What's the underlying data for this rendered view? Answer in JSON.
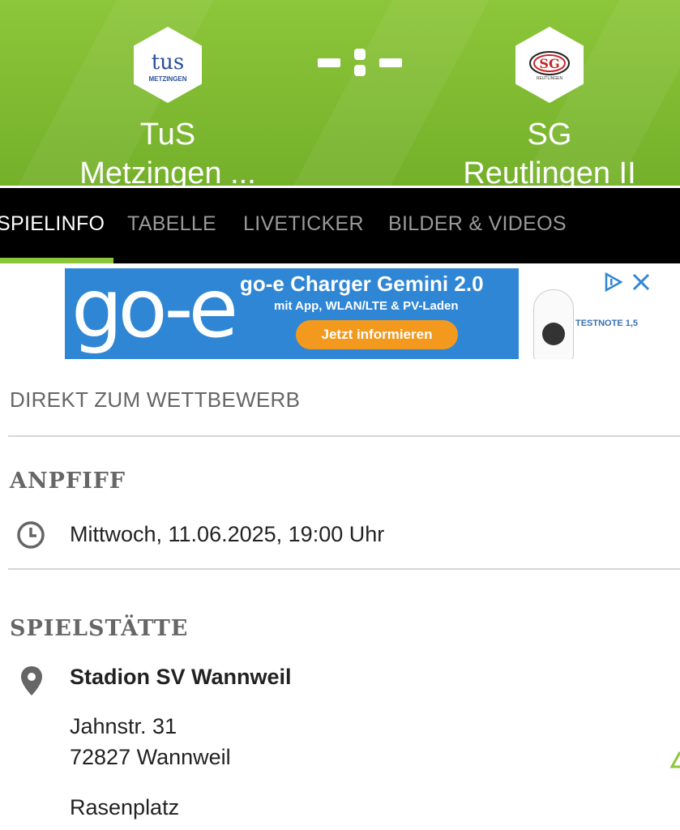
{
  "match": {
    "home_team": "TuS\nMetzingen ...",
    "away_team": "SG\nReutlingen II",
    "score": "-:-",
    "home_logo_text": "tus",
    "home_logo_sub": "METZINGEN",
    "away_logo_text": "SG",
    "away_logo_sub": "REUTLINGEN"
  },
  "tabs": [
    {
      "label": "SPIELINFO",
      "active": true
    },
    {
      "label": "TABELLE",
      "active": false
    },
    {
      "label": "LIVETICKER",
      "active": false
    },
    {
      "label": "BILDER & VIDEOS",
      "active": false
    }
  ],
  "ad": {
    "logo": "go-e",
    "title": "go-e Charger Gemini 2.0",
    "subtitle": "mit App, WLAN/LTE & PV-Laden",
    "cta": "Jetzt informieren",
    "testnote": "TESTNOTE 1,5",
    "icons": "ad-choices-icon close-icon"
  },
  "competition_link": "DIREKT ZUM WETTBEWERB",
  "kickoff": {
    "heading": "ANPFIFF",
    "datetime": "Mittwoch, 11.06.2025, 19:00 Uhr",
    "icon": "clock-icon"
  },
  "venue": {
    "heading": "SPIELSTÄTTE",
    "name": "Stadion SV Wannweil",
    "street": "Jahnstr. 31",
    "city": "72827 Wannweil",
    "surface": "Rasenplatz",
    "icon": "location-pin-icon"
  },
  "colors": {
    "header_green": "#8cc63a",
    "tab_bar": "#000000",
    "tab_indicator": "#8cc63a",
    "ad_blue": "#2f86d4",
    "ad_cta": "#f39a1e"
  }
}
